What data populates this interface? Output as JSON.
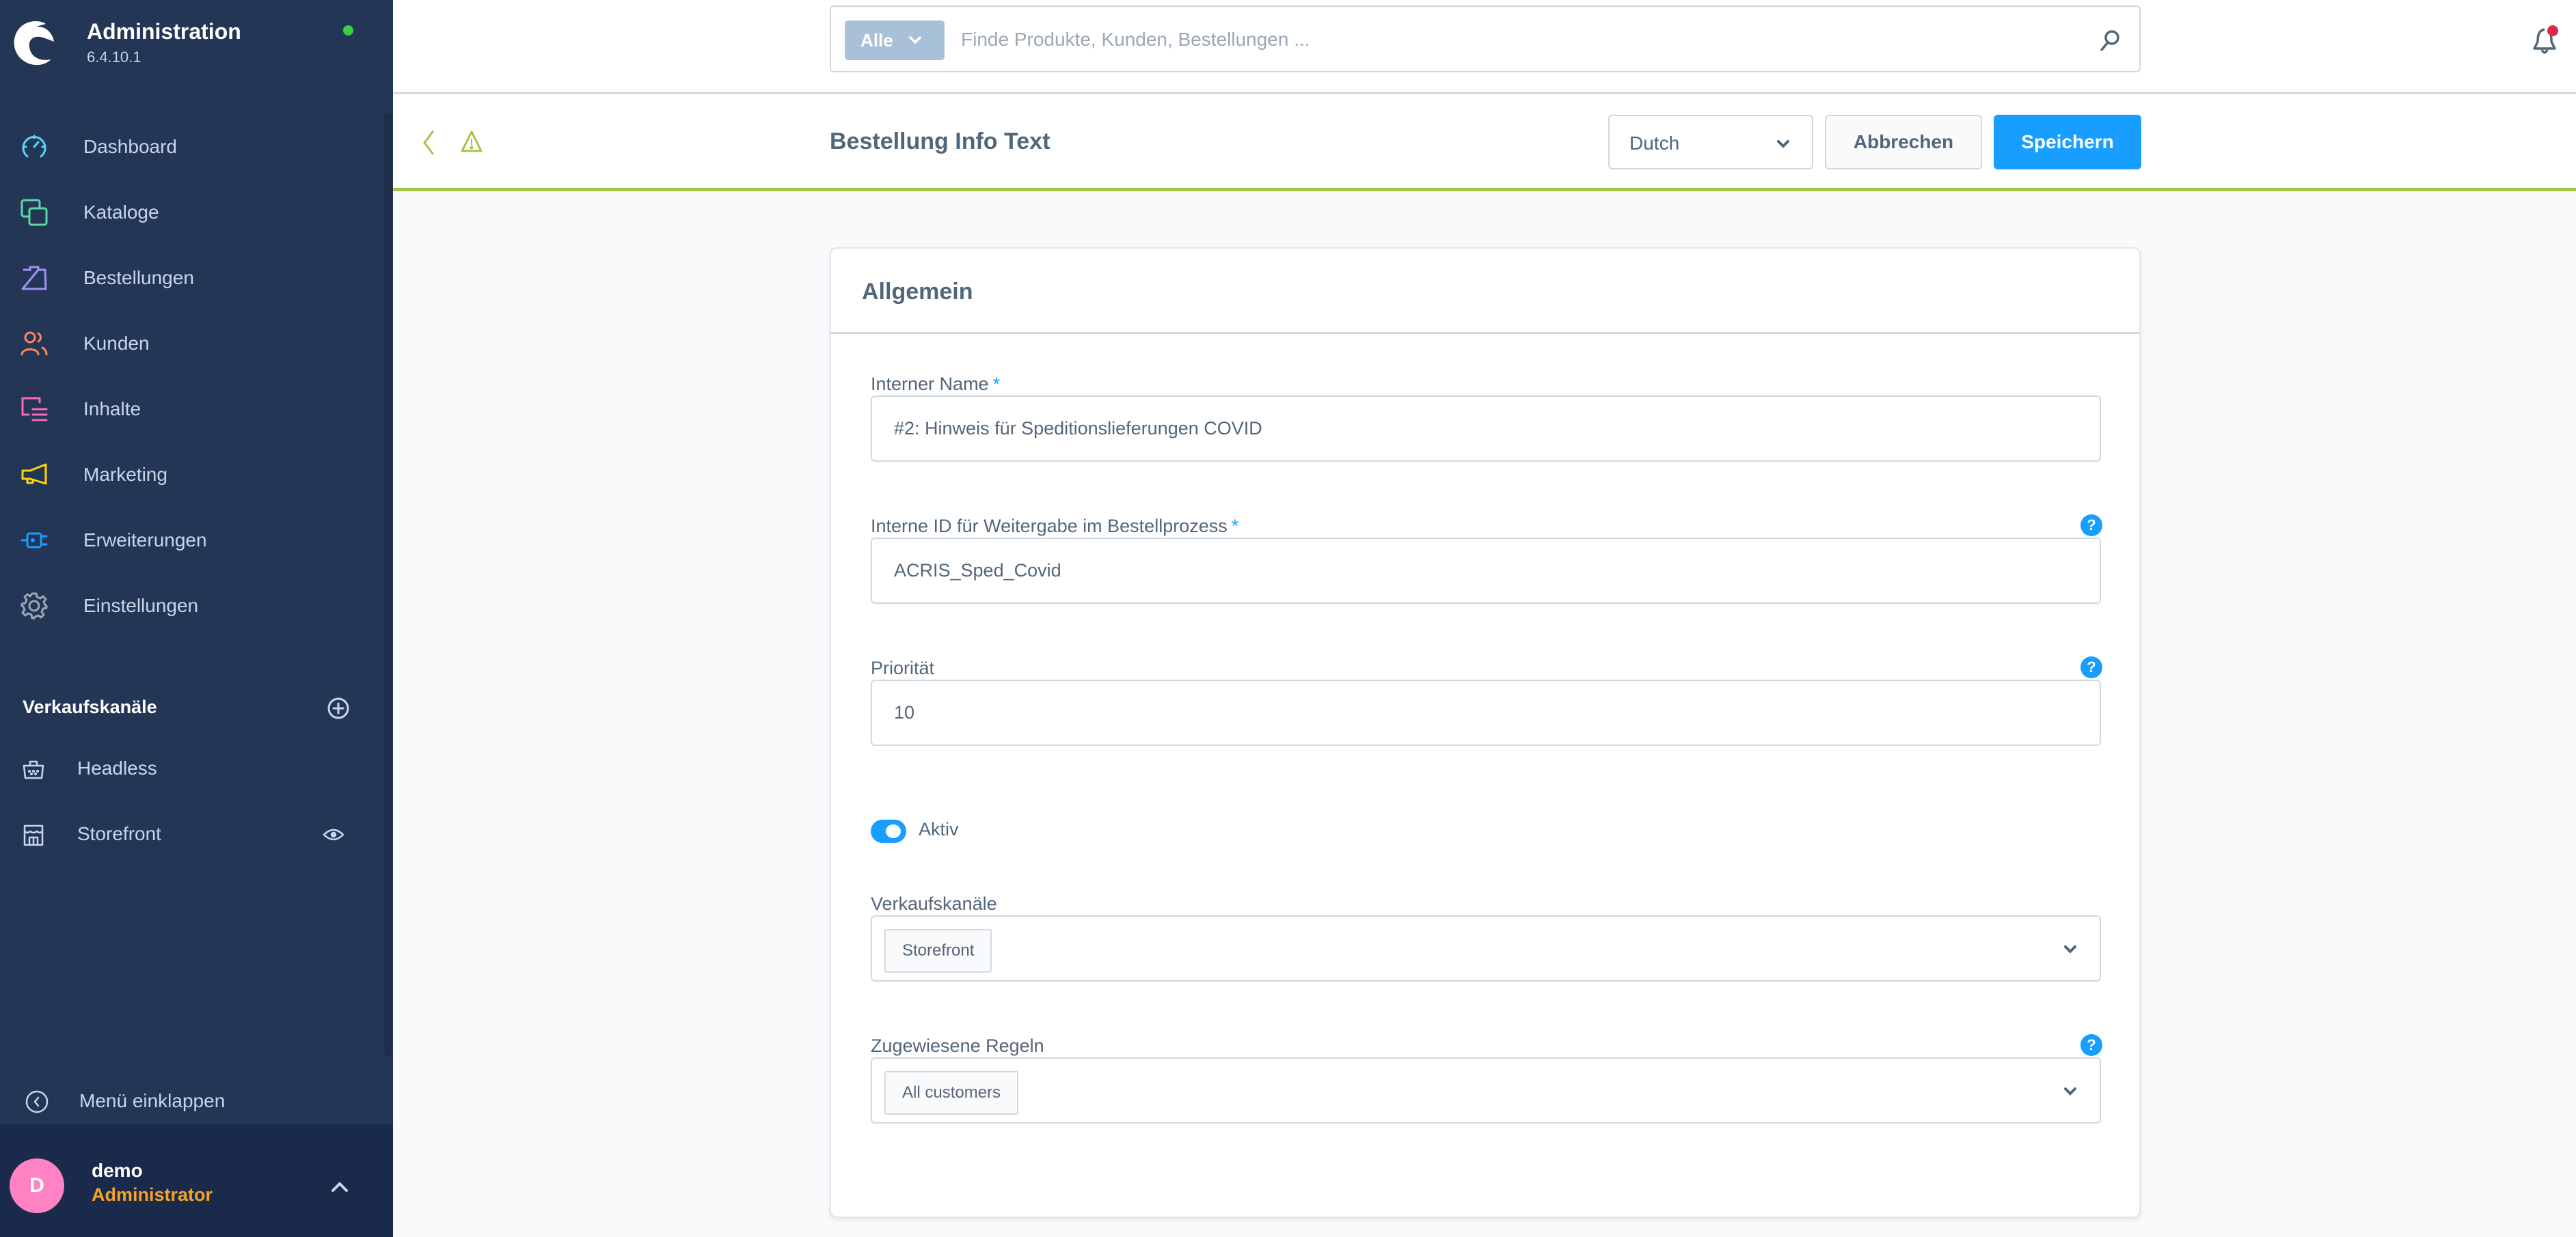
{
  "sidebar": {
    "app_title": "Administration",
    "version": "6.4.10.1",
    "status_color": "#37d046",
    "nav": [
      {
        "label": "Dashboard",
        "icon": "dashboard-icon",
        "color": "#57d9f9"
      },
      {
        "label": "Kataloge",
        "icon": "catalogues-icon",
        "color": "#57d9a3"
      },
      {
        "label": "Bestellungen",
        "icon": "orders-icon",
        "color": "#a092f0"
      },
      {
        "label": "Kunden",
        "icon": "customers-icon",
        "color": "#f88962"
      },
      {
        "label": "Inhalte",
        "icon": "content-icon",
        "color": "#ff68b4"
      },
      {
        "label": "Marketing",
        "icon": "marketing-icon",
        "color": "#ffd700"
      },
      {
        "label": "Erweiterungen",
        "icon": "extensions-icon",
        "color": "#189eff"
      },
      {
        "label": "Einstellungen",
        "icon": "settings-icon",
        "color": "#9aa8b5"
      }
    ],
    "sales_channels": {
      "title": "Verkaufskanäle",
      "items": [
        {
          "label": "Headless",
          "icon": "basket-icon"
        },
        {
          "label": "Storefront",
          "icon": "storefront-icon",
          "has_preview": true
        }
      ]
    },
    "collapse_label": "Menü einklappen",
    "user": {
      "initial": "D",
      "name": "demo",
      "role": "Administrator"
    }
  },
  "topbar": {
    "search_type": "Alle",
    "search_placeholder": "Finde Produkte, Kunden, Bestellungen ...",
    "search_value": "",
    "notification_badge": true
  },
  "smartbar": {
    "title": "Bestellung Info Text",
    "language": "Dutch",
    "cancel_label": "Abbrechen",
    "save_label": "Speichern"
  },
  "card": {
    "title": "Allgemein",
    "fields": {
      "internal_name": {
        "label": "Interner Name",
        "required": "*",
        "value": "#2: Hinweis für Speditionslieferungen COVID"
      },
      "internal_id": {
        "label": "Interne ID für Weitergabe im Bestellprozess",
        "required": "*",
        "value": "ACRIS_Sped_Covid",
        "help": "?"
      },
      "priority": {
        "label": "Priorität",
        "value": "10",
        "help": "?"
      },
      "active": {
        "label": "Aktiv",
        "checked": true
      },
      "sales_channels": {
        "label": "Verkaufskanäle",
        "selected": [
          "Storefront"
        ]
      },
      "rules": {
        "label": "Zugewiesene Regeln",
        "selected": [
          "All customers"
        ],
        "help": "?"
      }
    }
  },
  "colors": {
    "sidebar_bg": "#243656",
    "primary": "#189eff",
    "smartbar_accent": "#a4c34a",
    "role_color": "#f7a324",
    "avatar_bg": "#ff83c3",
    "notification": "#de294c"
  }
}
